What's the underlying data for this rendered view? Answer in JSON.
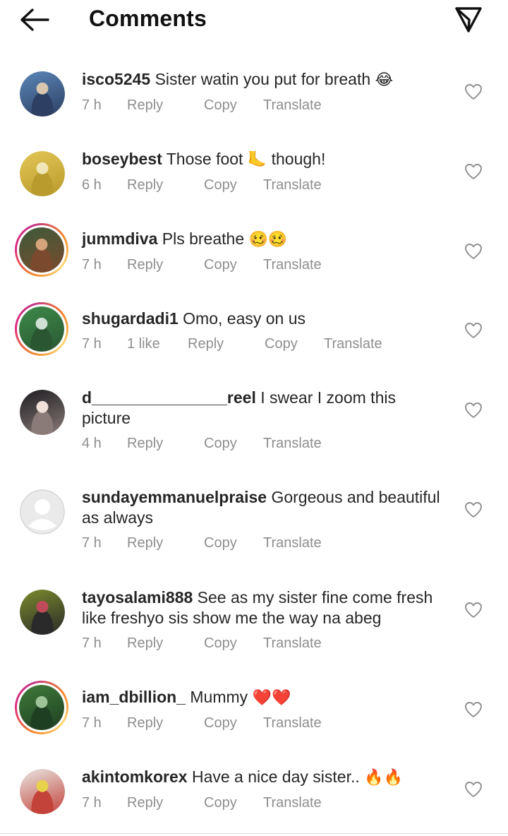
{
  "header": {
    "title": "Comments",
    "back_icon": "arrow-left-icon",
    "share_icon": "paper-plane-icon"
  },
  "actions": {
    "reply": "Reply",
    "copy": "Copy",
    "translate": "Translate"
  },
  "comments": [
    {
      "username": "isco5245",
      "text": "Sister watin you put for breath",
      "emoji": "😂",
      "time": "7 h",
      "likes": "",
      "ring": false,
      "avatar_colors": [
        "#5b87b8",
        "#2d3f63",
        "#d9c7b0"
      ]
    },
    {
      "username": "boseybest",
      "text": "Those foot",
      "emoji": "🦶",
      "text_after": "though!",
      "time": "6 h",
      "likes": "",
      "ring": false,
      "avatar_colors": [
        "#e2c655",
        "#b99a2c",
        "#f1e6b8"
      ]
    },
    {
      "username": "jummdiva",
      "text": "Pls breathe",
      "emoji": "🥴🥴",
      "time": "7 h",
      "likes": "",
      "ring": true,
      "avatar_colors": [
        "#3c5a3a",
        "#7b4a2e",
        "#d6a47a"
      ]
    },
    {
      "username": "shugardadi1",
      "text": "Omo, easy on us",
      "emoji": "",
      "time": "7 h",
      "likes": "1 like",
      "ring": true,
      "avatar_colors": [
        "#3d8a4a",
        "#2a5632",
        "#cfe0d4"
      ]
    },
    {
      "username": "d_______________reel",
      "text": "I swear I zoom this picture",
      "emoji": "",
      "time": "4 h",
      "likes": "",
      "ring": false,
      "avatar_colors": [
        "#1e1e22",
        "#8a7a78",
        "#f0e2da"
      ]
    },
    {
      "username": "sundayemmanuelpraise",
      "text": "Gorgeous and beautiful as always",
      "emoji": "",
      "time": "7 h",
      "likes": "",
      "ring": false,
      "avatar_colors": [
        "#dbdbdb",
        "#c7c7c7",
        "#ffffff"
      ]
    },
    {
      "username": "tayosalami888",
      "text": "See as my sister fine come fresh like freshyo sis show me the way na abeg",
      "emoji": "",
      "time": "7 h",
      "likes": "",
      "ring": false,
      "avatar_colors": [
        "#7a8a2c",
        "#2a2a2a",
        "#c04a5a"
      ]
    },
    {
      "username": "iam_dbillion_",
      "text": "Mummy",
      "emoji": "❤️❤️",
      "time": "7 h",
      "likes": "",
      "ring": true,
      "avatar_colors": [
        "#3f7a3a",
        "#1f3f22",
        "#9fc49a"
      ]
    },
    {
      "username": "akintomkorex",
      "text": "Have a nice day sister..",
      "emoji": "🔥🔥",
      "time": "7 h",
      "likes": "",
      "ring": false,
      "avatar_colors": [
        "#e8e6e2",
        "#c3423a",
        "#e8d24a"
      ]
    }
  ]
}
